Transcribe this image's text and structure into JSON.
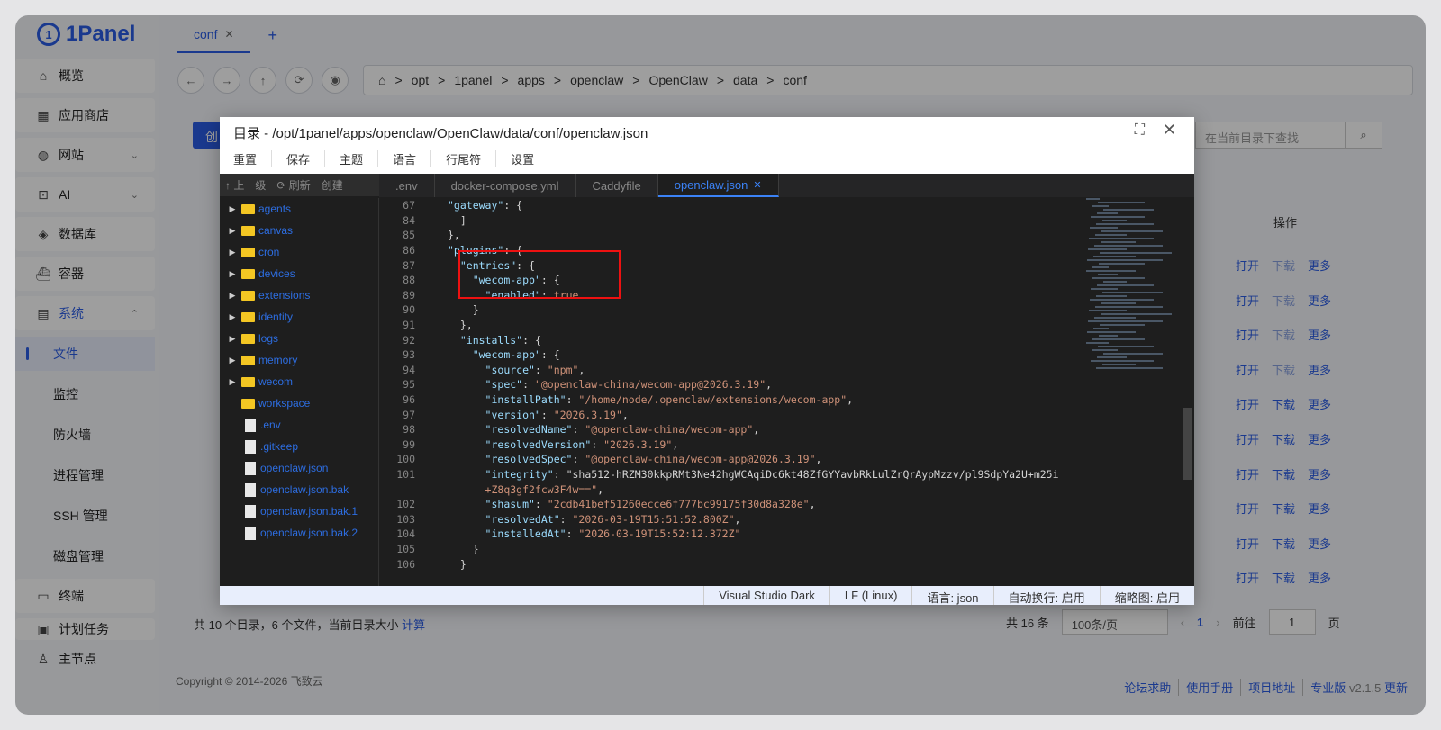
{
  "logo": "1Panel",
  "sidebar": {
    "items": [
      {
        "label": "概览"
      },
      {
        "label": "应用商店"
      },
      {
        "label": "网站"
      },
      {
        "label": "AI"
      },
      {
        "label": "数据库"
      },
      {
        "label": "容器"
      },
      {
        "label": "系统"
      }
    ],
    "sub": [
      "文件",
      "监控",
      "防火墙",
      "进程管理",
      "SSH 管理",
      "磁盘管理"
    ],
    "more": [
      "终端",
      "计划任务",
      "主节点"
    ]
  },
  "tabs": {
    "current": "conf"
  },
  "breadcrumb": [
    "opt",
    "1panel",
    "apps",
    "openclaw",
    "OpenClaw",
    "data",
    "conf"
  ],
  "search": {
    "placeholder": "在当前目录下查找"
  },
  "create_label": "创",
  "table": {
    "ops_header": "操作",
    "open": "打开",
    "download": "下载",
    "more": "更多"
  },
  "footer": {
    "summary": "共 10 个目录，6 个文件，当前目录大小",
    "calc": "计算",
    "total": "共 16 条",
    "per_page": "100条/页",
    "page": "1",
    "goto": "前往",
    "goto_value": "1",
    "page_unit": "页"
  },
  "copyright": "Copyright © 2014-2026 飞致云",
  "links": [
    "论坛求助",
    "使用手册",
    "项目地址",
    "专业版"
  ],
  "version": "v2.1.5",
  "update": "更新",
  "dialog": {
    "title": "目录 - /opt/1panel/apps/openclaw/OpenClaw/data/conf/openclaw.json",
    "menu": [
      "重置",
      "保存",
      "主题",
      "语言",
      "行尾符",
      "设置"
    ],
    "tree_toolbar": [
      "↑ 上一级",
      "⟳ 刷新",
      "创建"
    ],
    "files": [
      {
        "name": "agents",
        "type": "dir"
      },
      {
        "name": "canvas",
        "type": "dir"
      },
      {
        "name": "cron",
        "type": "dir"
      },
      {
        "name": "devices",
        "type": "dir"
      },
      {
        "name": "extensions",
        "type": "dir"
      },
      {
        "name": "identity",
        "type": "dir"
      },
      {
        "name": "logs",
        "type": "dir"
      },
      {
        "name": "memory",
        "type": "dir"
      },
      {
        "name": "wecom",
        "type": "dir"
      },
      {
        "name": "workspace",
        "type": "dir"
      },
      {
        "name": ".env",
        "type": "file"
      },
      {
        "name": ".gitkeep",
        "type": "file"
      },
      {
        "name": "openclaw.json",
        "type": "file"
      },
      {
        "name": "openclaw.json.bak",
        "type": "file"
      },
      {
        "name": "openclaw.json.bak.1",
        "type": "file"
      },
      {
        "name": "openclaw.json.bak.2",
        "type": "file"
      }
    ],
    "editor_tabs": [
      ".env",
      "docker-compose.yml",
      "Caddyfile",
      "openclaw.json"
    ],
    "code": [
      {
        "n": "67",
        "t": "\"gateway\": {"
      },
      {
        "n": "84",
        "t": "  ]"
      },
      {
        "n": "85",
        "t": "},"
      },
      {
        "n": "86",
        "t": "\"plugins\": {"
      },
      {
        "n": "87",
        "t": "  \"entries\": {"
      },
      {
        "n": "88",
        "t": "    \"wecom-app\": {"
      },
      {
        "n": "89",
        "t": "      \"enabled\": true"
      },
      {
        "n": "90",
        "t": "    }"
      },
      {
        "n": "91",
        "t": "  },"
      },
      {
        "n": "92",
        "t": "  \"installs\": {"
      },
      {
        "n": "93",
        "t": "    \"wecom-app\": {"
      },
      {
        "n": "94",
        "t": "      \"source\": \"npm\","
      },
      {
        "n": "95",
        "t": "      \"spec\": \"@openclaw-china/wecom-app@2026.3.19\","
      },
      {
        "n": "96",
        "t": "      \"installPath\": \"/home/node/.openclaw/extensions/wecom-app\","
      },
      {
        "n": "97",
        "t": "      \"version\": \"2026.3.19\","
      },
      {
        "n": "98",
        "t": "      \"resolvedName\": \"@openclaw-china/wecom-app\","
      },
      {
        "n": "99",
        "t": "      \"resolvedVersion\": \"2026.3.19\","
      },
      {
        "n": "100",
        "t": "      \"resolvedSpec\": \"@openclaw-china/wecom-app@2026.3.19\","
      },
      {
        "n": "101",
        "t": "      \"integrity\": \"sha512-hRZM30kkpRMt3Ne42hgWCAqiDc6kt48ZfGYYavbRkLulZrQrAypMzzv/pl9SdpYa2U+m25i"
      },
      {
        "n": "",
        "t": "      +Z8q3gf2fcw3F4w==\","
      },
      {
        "n": "102",
        "t": "      \"shasum\": \"2cdb41bef51260ecce6f777bc99175f30d8a328e\","
      },
      {
        "n": "103",
        "t": "      \"resolvedAt\": \"2026-03-19T15:51:52.800Z\","
      },
      {
        "n": "104",
        "t": "      \"installedAt\": \"2026-03-19T15:52:12.372Z\""
      },
      {
        "n": "105",
        "t": "    }"
      },
      {
        "n": "106",
        "t": "  }"
      }
    ],
    "status": [
      "Visual Studio Dark",
      "LF (Linux)",
      "语言: json",
      "自动换行: 启用",
      "缩略图: 启用"
    ]
  }
}
